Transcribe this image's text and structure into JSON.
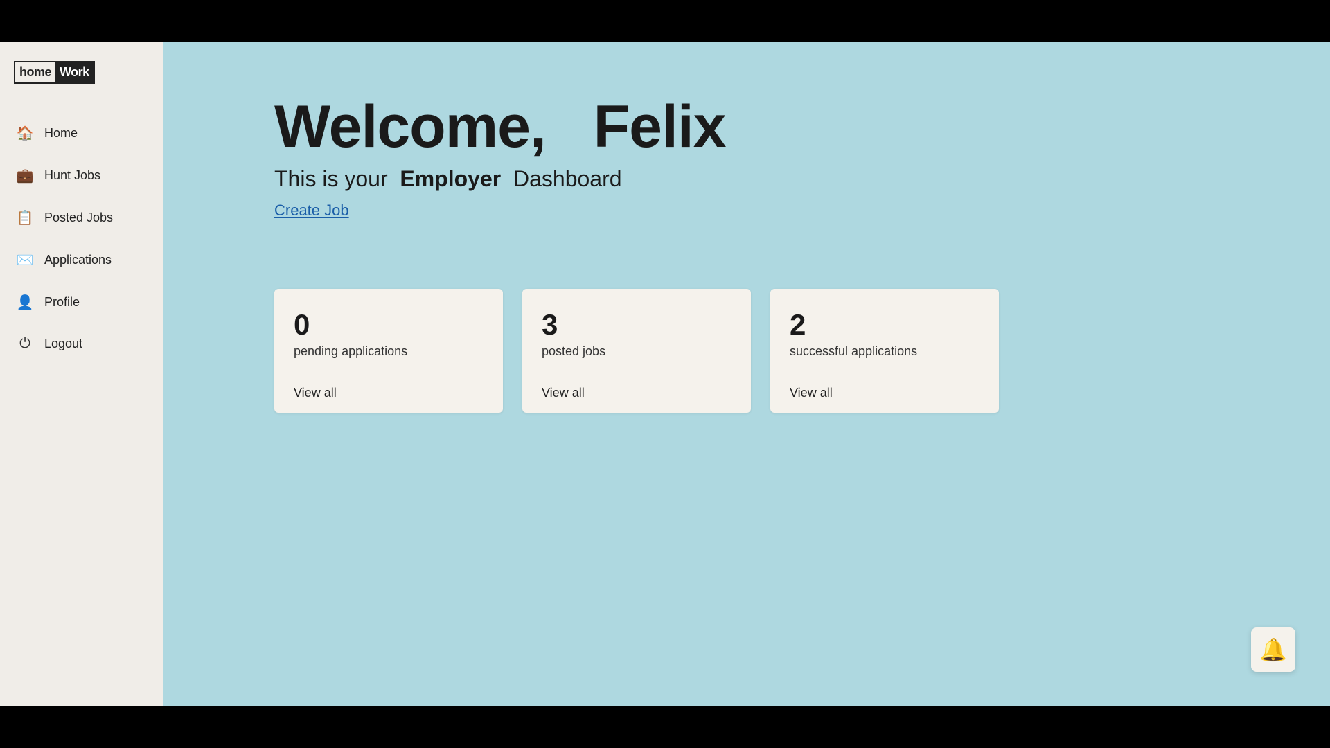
{
  "logo": {
    "home": "home",
    "work": "Work"
  },
  "sidebar": {
    "nav_items": [
      {
        "id": "home",
        "label": "Home",
        "icon": "🏠"
      },
      {
        "id": "hunt-jobs",
        "label": "Hunt Jobs",
        "icon": "💼"
      },
      {
        "id": "posted-jobs",
        "label": "Posted Jobs",
        "icon": "📋"
      },
      {
        "id": "applications",
        "label": "Applications",
        "icon": "✉️"
      },
      {
        "id": "profile",
        "label": "Profile",
        "icon": "👤"
      },
      {
        "id": "logout",
        "label": "Logout",
        "icon": "⏻"
      }
    ]
  },
  "main": {
    "welcome_prefix": "Welcome,",
    "user_name": "Felix",
    "subtitle_prefix": "This is your",
    "subtitle_bold": "Employer",
    "subtitle_suffix": "Dashboard",
    "create_job_label": "Create Job",
    "cards": [
      {
        "id": "pending-applications",
        "count": "0",
        "label": "pending applications",
        "view_all": "View all"
      },
      {
        "id": "posted-jobs",
        "count": "3",
        "label": "posted jobs",
        "view_all": "View all"
      },
      {
        "id": "successful-applications",
        "count": "2",
        "label": "successful applications",
        "view_all": "View all"
      }
    ]
  },
  "notification": {
    "icon": "🔔"
  }
}
